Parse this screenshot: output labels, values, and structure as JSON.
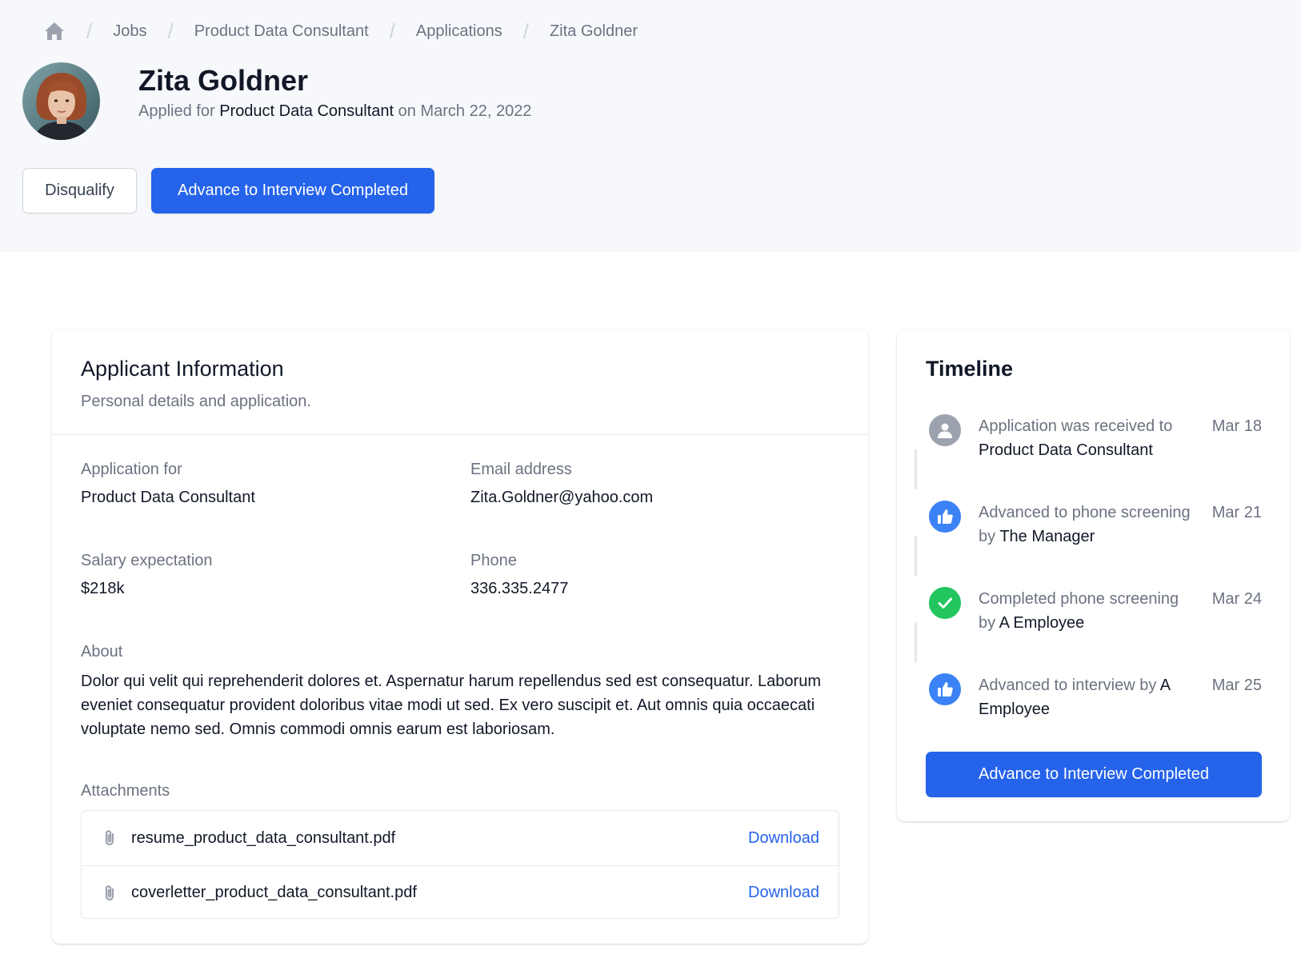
{
  "breadcrumb": {
    "home_icon": "home-icon",
    "items": [
      "Jobs",
      "Product Data Consultant",
      "Applications",
      "Zita Goldner"
    ]
  },
  "applicant": {
    "name": "Zita Goldner",
    "applied_prefix": "Applied for",
    "applied_job": "Product Data Consultant",
    "applied_suffix": "on March 22, 2022"
  },
  "actions": {
    "disqualify_label": "Disqualify",
    "advance_label": "Advance to Interview Completed"
  },
  "info": {
    "title": "Applicant Information",
    "subtitle": "Personal details and application.",
    "application_for_label": "Application for",
    "application_for_value": "Product Data Consultant",
    "email_label": "Email address",
    "email_value": "Zita.Goldner@yahoo.com",
    "salary_label": "Salary expectation",
    "salary_value": "$218k",
    "phone_label": "Phone",
    "phone_value": "336.335.2477",
    "about_label": "About",
    "about_value": "Dolor qui velit qui reprehenderit dolores et. Aspernatur harum repellendus sed est consequatur. Laborum eveniet consequatur provident doloribus vitae modi ut sed. Ex vero suscipit et. Aut omnis quia occaecati voluptate nemo sed. Omnis commodi omnis earum est laboriosam.",
    "attachments_label": "Attachments",
    "attachments": [
      {
        "file": "resume_product_data_consultant.pdf",
        "action": "Download"
      },
      {
        "file": "coverletter_product_data_consultant.pdf",
        "action": "Download"
      }
    ]
  },
  "timeline": {
    "title": "Timeline",
    "events": [
      {
        "text": "Application was received to",
        "target": "Product Data Consultant",
        "date": "Mar 18",
        "icon": "user-icon",
        "color": "#9ca3af"
      },
      {
        "text": "Advanced to phone screening by",
        "target": "The Manager",
        "date": "Mar 21",
        "icon": "thumbs-up-icon",
        "color": "#3b82f6"
      },
      {
        "text": "Completed phone screening by",
        "target": "A Employee",
        "date": "Mar 24",
        "icon": "check-icon",
        "color": "#22c55e"
      },
      {
        "text": "Advanced to interview by",
        "target": "A Employee",
        "date": "Mar 25",
        "icon": "thumbs-up-icon",
        "color": "#3b82f6"
      }
    ],
    "advance_label": "Advance to Interview Completed"
  },
  "colors": {
    "accent": "#2563eb",
    "header_bg": "#f7f8fc"
  }
}
